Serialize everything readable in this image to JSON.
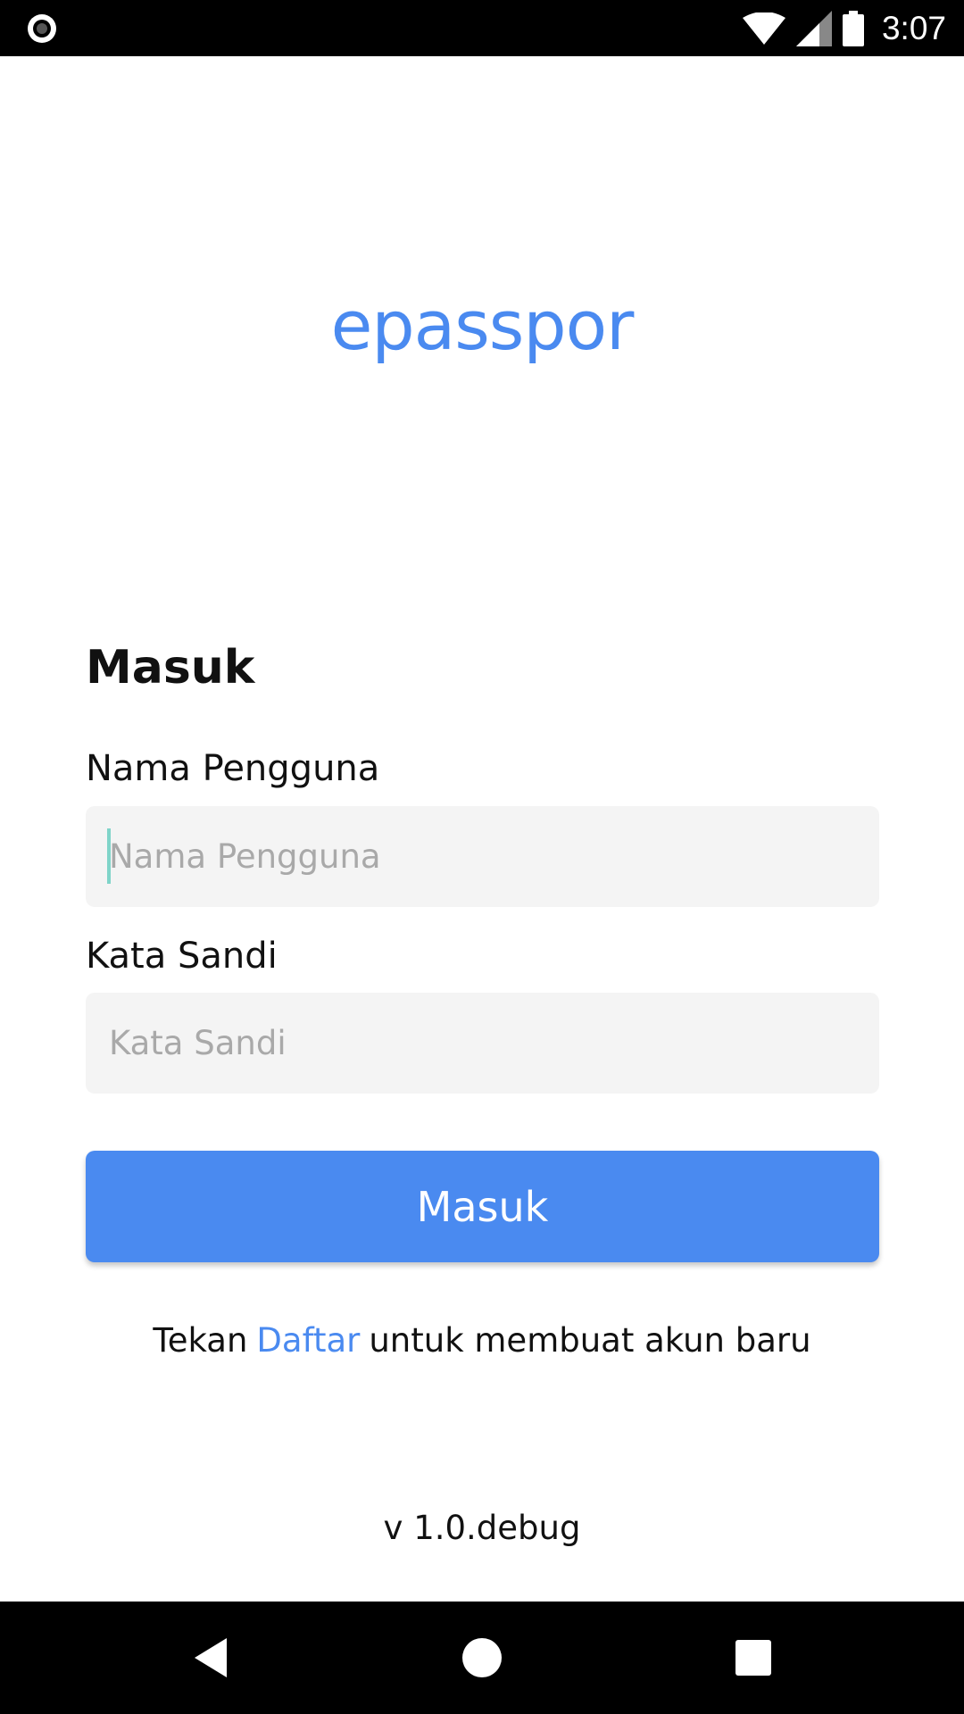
{
  "status_bar": {
    "time": "3:07",
    "icons": [
      "record-icon",
      "wifi-icon",
      "signal-icon",
      "battery-icon"
    ]
  },
  "app": {
    "logo_text": "epasspor",
    "brand_color": "#4a8af0"
  },
  "login_form": {
    "heading": "Masuk",
    "username": {
      "label": "Nama Pengguna",
      "placeholder": "Nama Pengguna",
      "value": ""
    },
    "password": {
      "label": "Kata Sandi",
      "placeholder": "Kata Sandi",
      "value": ""
    },
    "submit_label": "Masuk"
  },
  "register": {
    "prefix": "Tekan",
    "link_text": "Daftar",
    "suffix": "untuk membuat akun baru"
  },
  "footer": {
    "version": "v 1.0.debug"
  },
  "nav_bar": {
    "icons": [
      "back-icon",
      "home-icon",
      "recents-icon"
    ]
  }
}
